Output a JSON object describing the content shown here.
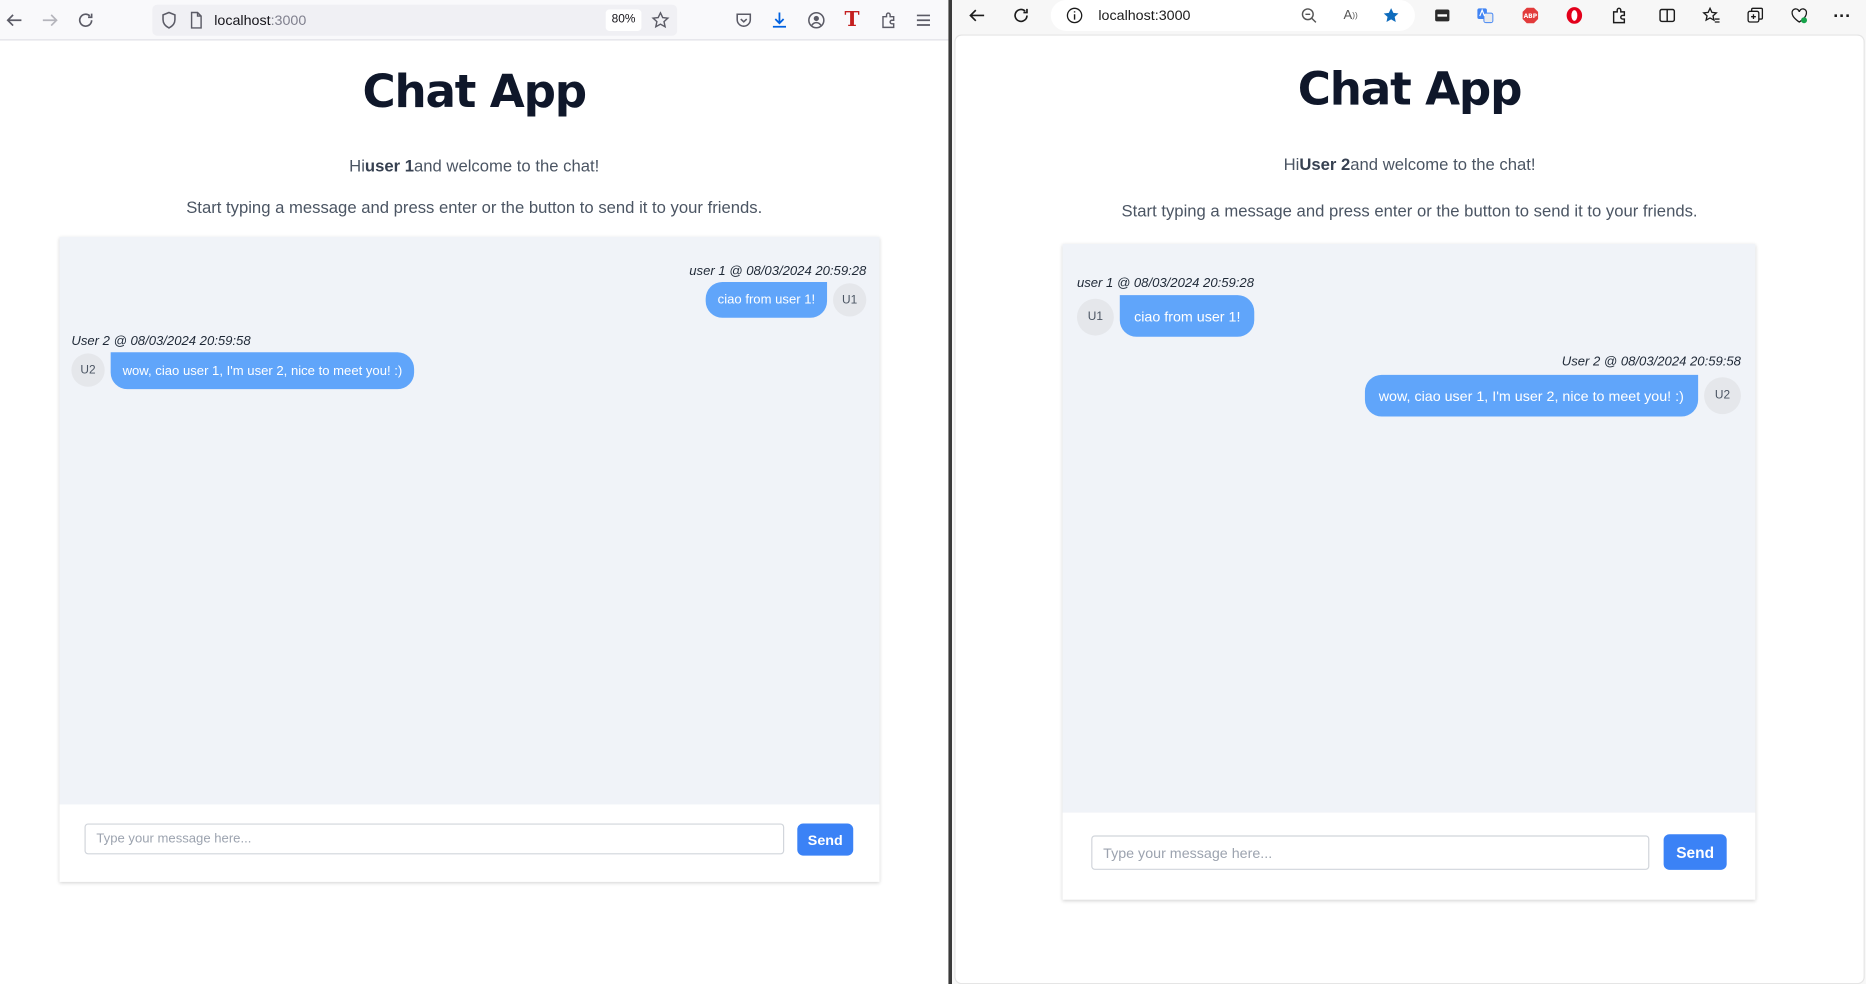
{
  "left_browser": {
    "url_host": "localhost",
    "url_port": ":3000",
    "zoom": "80%",
    "icons": [
      "back-icon",
      "forward-icon",
      "reload-icon",
      "shield-icon",
      "page-icon",
      "star-icon",
      "pocket-icon",
      "download-icon",
      "account-icon",
      "reader-t-icon",
      "extensions-icon",
      "menu-icon"
    ]
  },
  "right_browser": {
    "url": "localhost:3000",
    "icons": [
      "back-icon",
      "reload-icon",
      "info-icon",
      "zoom-out-icon",
      "read-aloud-icon",
      "favorite-star-icon",
      "ext-1-icon",
      "translate-icon",
      "adblock-icon",
      "opera-icon",
      "extensions-icon",
      "split-screen-icon",
      "favorites-icon",
      "collections-icon",
      "health-icon",
      "more-icon"
    ]
  },
  "left_app": {
    "title": "Chat App",
    "greeting_prefix": "Hi",
    "username": "user 1",
    "greeting_suffix": "and welcome to the chat!",
    "intro": "Start typing a message and press enter or the button to send it to your friends.",
    "input_placeholder": "Type your message here...",
    "send_label": "Send",
    "messages": [
      {
        "meta": "user 1 @ 08/03/2024 20:59:28",
        "avatar": "U1",
        "text": "ciao from user 1!",
        "own": true
      },
      {
        "meta": "User 2 @ 08/03/2024 20:59:58",
        "avatar": "U2",
        "text": "wow, ciao user 1, I'm user 2, nice to meet you! :)",
        "own": false
      }
    ]
  },
  "right_app": {
    "title": "Chat App",
    "greeting_prefix": "Hi",
    "username": "User 2",
    "greeting_suffix": "and welcome to the chat!",
    "intro": "Start typing a message and press enter or the button to send it to your friends.",
    "input_placeholder": "Type your message here...",
    "send_label": "Send",
    "messages": [
      {
        "meta": "user 1 @ 08/03/2024 20:59:28",
        "avatar": "U1",
        "text": "ciao from user 1!",
        "own": false
      },
      {
        "meta": "User 2 @ 08/03/2024 20:59:58",
        "avatar": "U2",
        "text": "wow, ciao user 1, I'm user 2, nice to meet you! :)",
        "own": true
      }
    ]
  },
  "colors": {
    "accent": "#3b82f6",
    "bubble": "#60a5fa",
    "chat_bg": "#f0f3f8",
    "title": "#0f172a"
  }
}
